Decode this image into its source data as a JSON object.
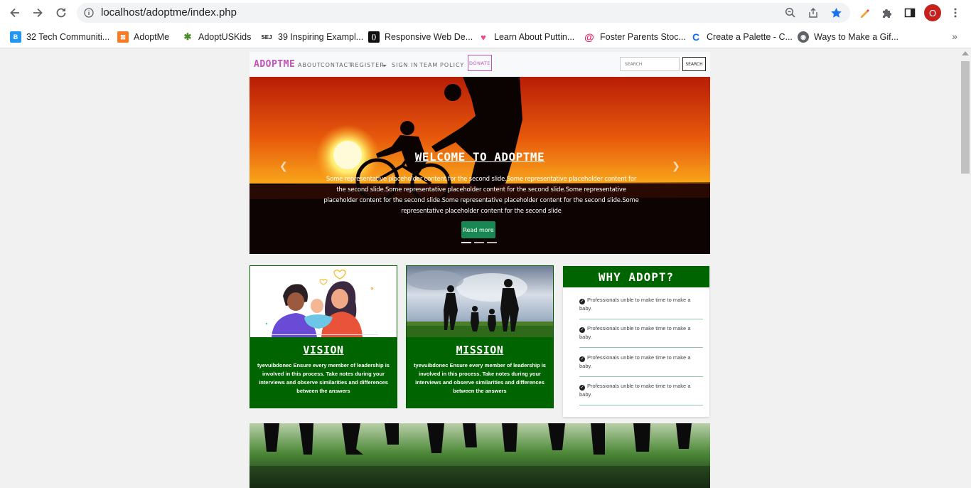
{
  "browser": {
    "url": "localhost/adoptme/index.php",
    "avatar_letter": "O",
    "bookmarks": [
      {
        "label": "32 Tech Communiti...",
        "icon": "site-favicon"
      },
      {
        "label": "AdoptMe",
        "icon": "xampp-favicon"
      },
      {
        "label": "AdoptUSKids",
        "icon": "adoptuskids-favicon"
      },
      {
        "label": "39 Inspiring Exampl...",
        "icon": "sej-favicon"
      },
      {
        "label": "Responsive Web De...",
        "icon": "webdesign-favicon"
      },
      {
        "label": "Learn About Puttin...",
        "icon": "heart-favicon"
      },
      {
        "label": "Foster Parents Stoc...",
        "icon": "dreamstime-favicon"
      },
      {
        "label": "Create a Palette - C...",
        "icon": "coolors-favicon"
      },
      {
        "label": "Ways to Make a Gif...",
        "icon": "globe-favicon"
      }
    ],
    "sej_badge": "SEJ"
  },
  "site": {
    "brand": "ADOPTME",
    "nav": [
      "ABOUT",
      "CONTACT",
      "REGISTER",
      "SIGN IN",
      "TEAM",
      "POLICY"
    ],
    "donate": "DONATE",
    "search_placeholder": "SEARCH",
    "search_button": "SEARCH"
  },
  "hero": {
    "title": "WELCOME TO ADOPTME",
    "text": "Some representative placeholder content for the second slide.Some representative placeholder content for the second slide.Some representative placeholder content for the second slide.Some representative placeholder content for the second slide.Some representative placeholder content for the second slide.Some representative placeholder content for the second slide",
    "button": "Read more",
    "slide_count": 3,
    "active_slide": 1
  },
  "cards": [
    {
      "title": "VISION",
      "text": "tyevuibdonec Ensure every member of leadership is involved in this process. Take notes during your interviews and observe similarities and differences between the answers"
    },
    {
      "title": "MISSION",
      "text": "tyevuibdonec Ensure every member of leadership is involved in this process. Take notes during your interviews and observe similarities and differences between the answers"
    }
  ],
  "why": {
    "title": "WHY ADOPT?",
    "items": [
      "Professionals unble to make time to make a baby.",
      "Professionals unble to make time to make a baby.",
      "Professionals unble to make time to make a baby.",
      "Professionals unble to make time to make a baby."
    ]
  },
  "colors": {
    "brand": "#c053b9",
    "green": "#006400",
    "button_green": "#198754"
  }
}
